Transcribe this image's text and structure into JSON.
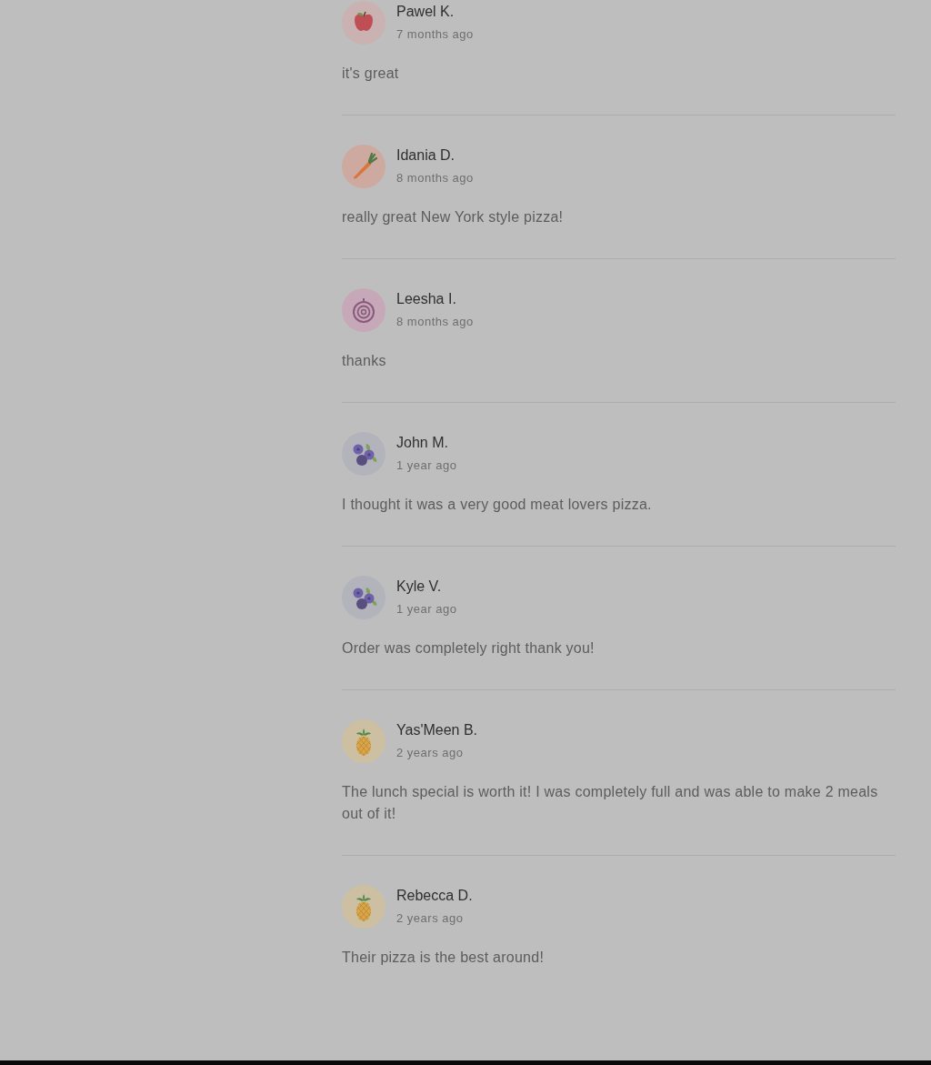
{
  "reviews": [
    {
      "name": "Pawel K.",
      "time": "7 months ago",
      "comment": "it's great",
      "avatar": {
        "kind": "apple"
      }
    },
    {
      "name": "Idania D.",
      "time": "8 months ago",
      "comment": "really great New York style pizza!",
      "avatar": {
        "kind": "carrot"
      }
    },
    {
      "name": "Leesha I.",
      "time": "8 months ago",
      "comment": "thanks",
      "avatar": {
        "kind": "onion"
      }
    },
    {
      "name": "John M.",
      "time": "1 year ago",
      "comment": "I thought it was a very good meat lovers pizza.",
      "avatar": {
        "kind": "berries"
      }
    },
    {
      "name": "Kyle V.",
      "time": "1 year ago",
      "comment": "Order was completely right thank you!",
      "avatar": {
        "kind": "berries"
      }
    },
    {
      "name": "Yas'Meen B.",
      "time": "2 years ago",
      "comment": "The lunch special is worth it! I was completely full and was able to make 2 meals out of it!",
      "avatar": {
        "kind": "pineapple"
      }
    },
    {
      "name": "Rebecca D.",
      "time": "2 years ago",
      "comment": "Their pizza is the best around!",
      "avatar": {
        "kind": "pineapple"
      }
    }
  ]
}
